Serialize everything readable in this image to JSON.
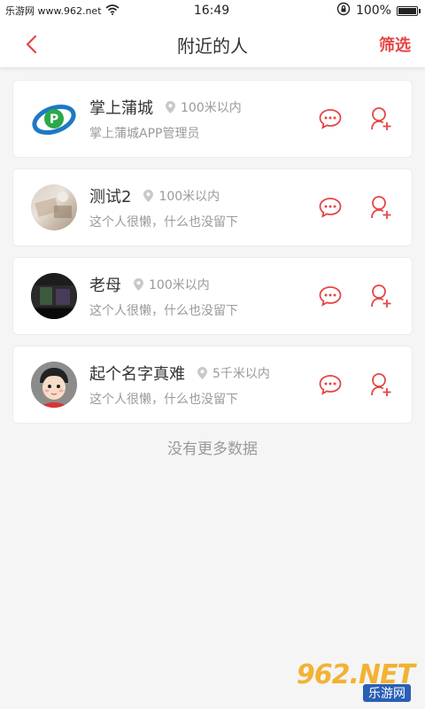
{
  "status_bar": {
    "carrier": "乐游网 www.962.net",
    "time": "16:49",
    "battery": "100%",
    "battery_level": 1.0
  },
  "nav": {
    "title": "附近的人",
    "filter_label": "筛选"
  },
  "people": [
    {
      "name": "掌上蒲城",
      "distance": "100米以内",
      "desc": "掌上蒲城APP管理员"
    },
    {
      "name": "测试2",
      "distance": "100米以内",
      "desc": "这个人很懒，什么也没留下"
    },
    {
      "name": "老母",
      "distance": "100米以内",
      "desc": "这个人很懒，什么也没留下"
    },
    {
      "name": "起个名字真难",
      "distance": "5千米以内",
      "desc": "这个人很懒，什么也没留下"
    }
  ],
  "footer": {
    "no_more": "没有更多数据"
  },
  "watermark": {
    "logo": "962.NET",
    "sub": "乐游网"
  },
  "colors": {
    "accent": "#e64545",
    "muted": "#9a9a9a"
  }
}
